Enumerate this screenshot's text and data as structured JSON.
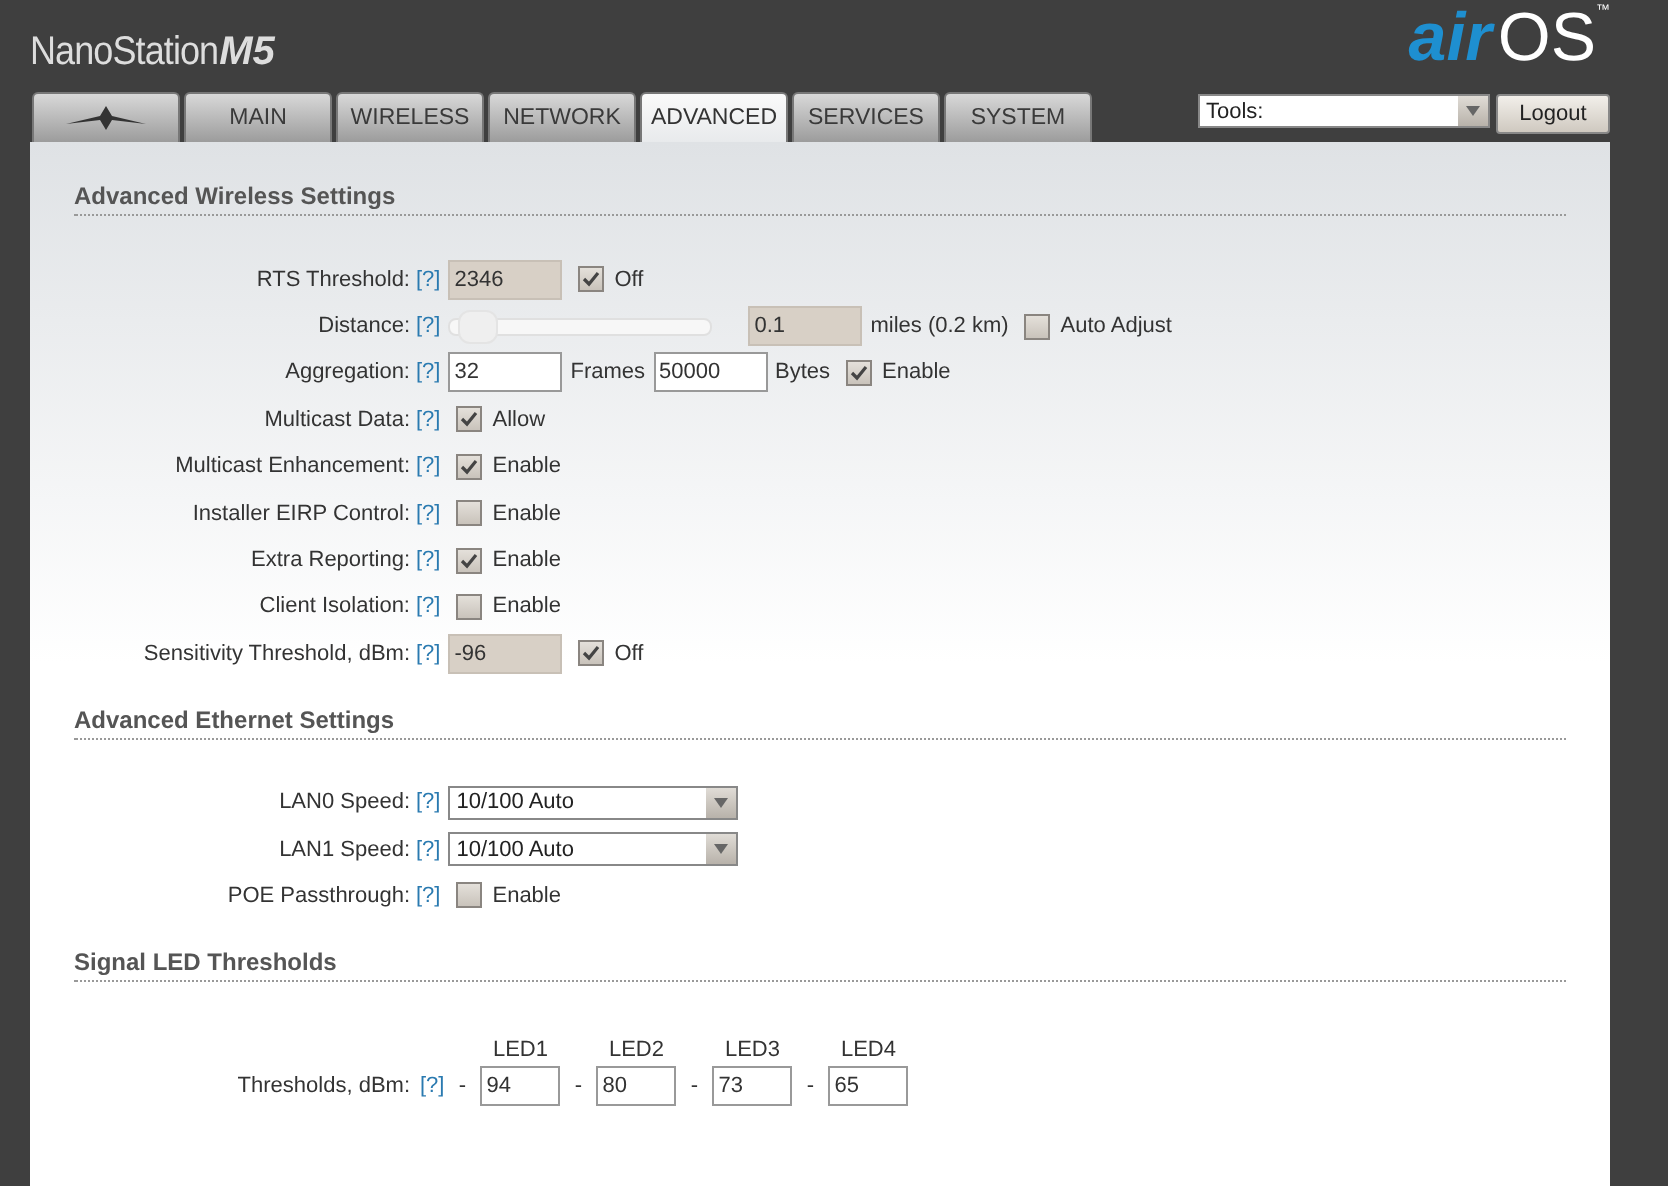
{
  "header": {
    "product": "NanoStation",
    "model": "M5",
    "logo_left": "air",
    "logo_right": "OS",
    "trademark": "™"
  },
  "tabs": [
    {
      "kind": "logo",
      "selected": false
    },
    {
      "kind": "text",
      "label": "MAIN",
      "selected": false
    },
    {
      "kind": "text",
      "label": "WIRELESS",
      "selected": false
    },
    {
      "kind": "text",
      "label": "NETWORK",
      "selected": false
    },
    {
      "kind": "text",
      "label": "ADVANCED",
      "selected": true
    },
    {
      "kind": "text",
      "label": "SERVICES",
      "selected": false
    },
    {
      "kind": "text",
      "label": "SYSTEM",
      "selected": false
    }
  ],
  "tools": {
    "value": "Tools:"
  },
  "logout": "Logout",
  "sections": [
    {
      "title": "Advanced Wireless Settings",
      "rows": [
        {
          "label": "RTS Threshold:",
          "help": "[?]",
          "controls": [
            {
              "kind": "field",
              "value": "2346",
              "disabled": true
            },
            {
              "kind": "checkbox",
              "checked": true,
              "label": "Off"
            }
          ]
        },
        {
          "label": "Distance:",
          "help": "[?]",
          "controls": [
            {
              "kind": "slider",
              "level": 0.03
            },
            {
              "kind": "field",
              "value": "0.1",
              "disabled": true
            },
            {
              "kind": "text",
              "text": "miles (0.2 km)"
            },
            {
              "kind": "checkbox",
              "checked": false,
              "label": "Auto Adjust"
            }
          ]
        },
        {
          "label": "Aggregation:",
          "help": "[?]",
          "controls": [
            {
              "kind": "field",
              "value": "32",
              "disabled": false
            },
            {
              "kind": "text",
              "text": "Frames"
            },
            {
              "kind": "field",
              "value": "50000",
              "disabled": false
            },
            {
              "kind": "text",
              "text": "Bytes"
            },
            {
              "kind": "checkbox",
              "checked": true,
              "label": "Enable"
            }
          ]
        },
        {
          "label": "Multicast Data:",
          "help": "[?]",
          "controls": [
            {
              "kind": "checkbox",
              "checked": true,
              "label": "Allow"
            }
          ]
        },
        {
          "label": "Multicast Enhancement:",
          "help": "[?]",
          "controls": [
            {
              "kind": "checkbox",
              "checked": true,
              "label": "Enable"
            }
          ]
        },
        {
          "label": "Installer EIRP Control:",
          "help": "[?]",
          "controls": [
            {
              "kind": "checkbox",
              "checked": false,
              "label": "Enable"
            }
          ]
        },
        {
          "label": "Extra Reporting:",
          "help": "[?]",
          "controls": [
            {
              "kind": "checkbox",
              "checked": true,
              "label": "Enable"
            }
          ]
        },
        {
          "label": "Client Isolation:",
          "help": "[?]",
          "controls": [
            {
              "kind": "checkbox",
              "checked": false,
              "label": "Enable"
            }
          ]
        },
        {
          "label": "Sensitivity Threshold, dBm:",
          "help": "[?]",
          "controls": [
            {
              "kind": "field",
              "value": "-96",
              "disabled": true
            },
            {
              "kind": "checkbox",
              "checked": true,
              "label": "Off"
            }
          ]
        }
      ]
    },
    {
      "title": "Advanced Ethernet Settings",
      "rows": [
        {
          "label": "LAN0 Speed:",
          "help": "[?]",
          "controls": [
            {
              "kind": "select",
              "value": "10/100 Auto"
            }
          ]
        },
        {
          "label": "LAN1 Speed:",
          "help": "[?]",
          "controls": [
            {
              "kind": "select",
              "value": "10/100 Auto"
            }
          ]
        },
        {
          "label": "POE Passthrough:",
          "help": "[?]",
          "controls": [
            {
              "kind": "checkbox",
              "checked": false,
              "label": "Enable"
            }
          ]
        }
      ]
    },
    {
      "title": "Signal LED Thresholds",
      "leds": {
        "label": "Thresholds, dBm:",
        "help": "[?]",
        "items": [
          {
            "name": "LED1",
            "dash": "-",
            "value": "94"
          },
          {
            "name": "LED2",
            "dash": "-",
            "value": "80"
          },
          {
            "name": "LED3",
            "dash": "-",
            "value": "73"
          },
          {
            "name": "LED4",
            "dash": "-",
            "value": "65"
          }
        ]
      }
    }
  ]
}
